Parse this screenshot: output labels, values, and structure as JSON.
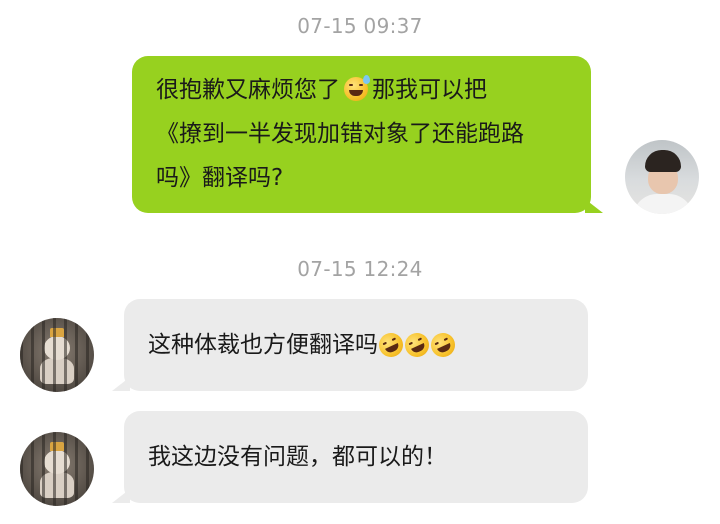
{
  "conversation": {
    "timestamps": [
      "07-15 09:37",
      "07-15 12:24"
    ],
    "outgoing": {
      "line1_before": "很抱歉又麻烦您了",
      "line1_emoji": "grinning-sweat-emoji",
      "line1_after": "那我可以把",
      "line2": "《撩到一半发现加错对象了还能跑路",
      "line3": "吗》翻译吗?",
      "bubble_color": "#97d11f"
    },
    "incoming": [
      {
        "text": "这种体裁也方便翻译吗",
        "emojis": [
          "rofl-emoji",
          "rofl-emoji",
          "rofl-emoji"
        ]
      },
      {
        "text": "我这边没有问题，都可以的！",
        "emojis": []
      }
    ],
    "incoming_bubble_color": "#ebebeb"
  }
}
